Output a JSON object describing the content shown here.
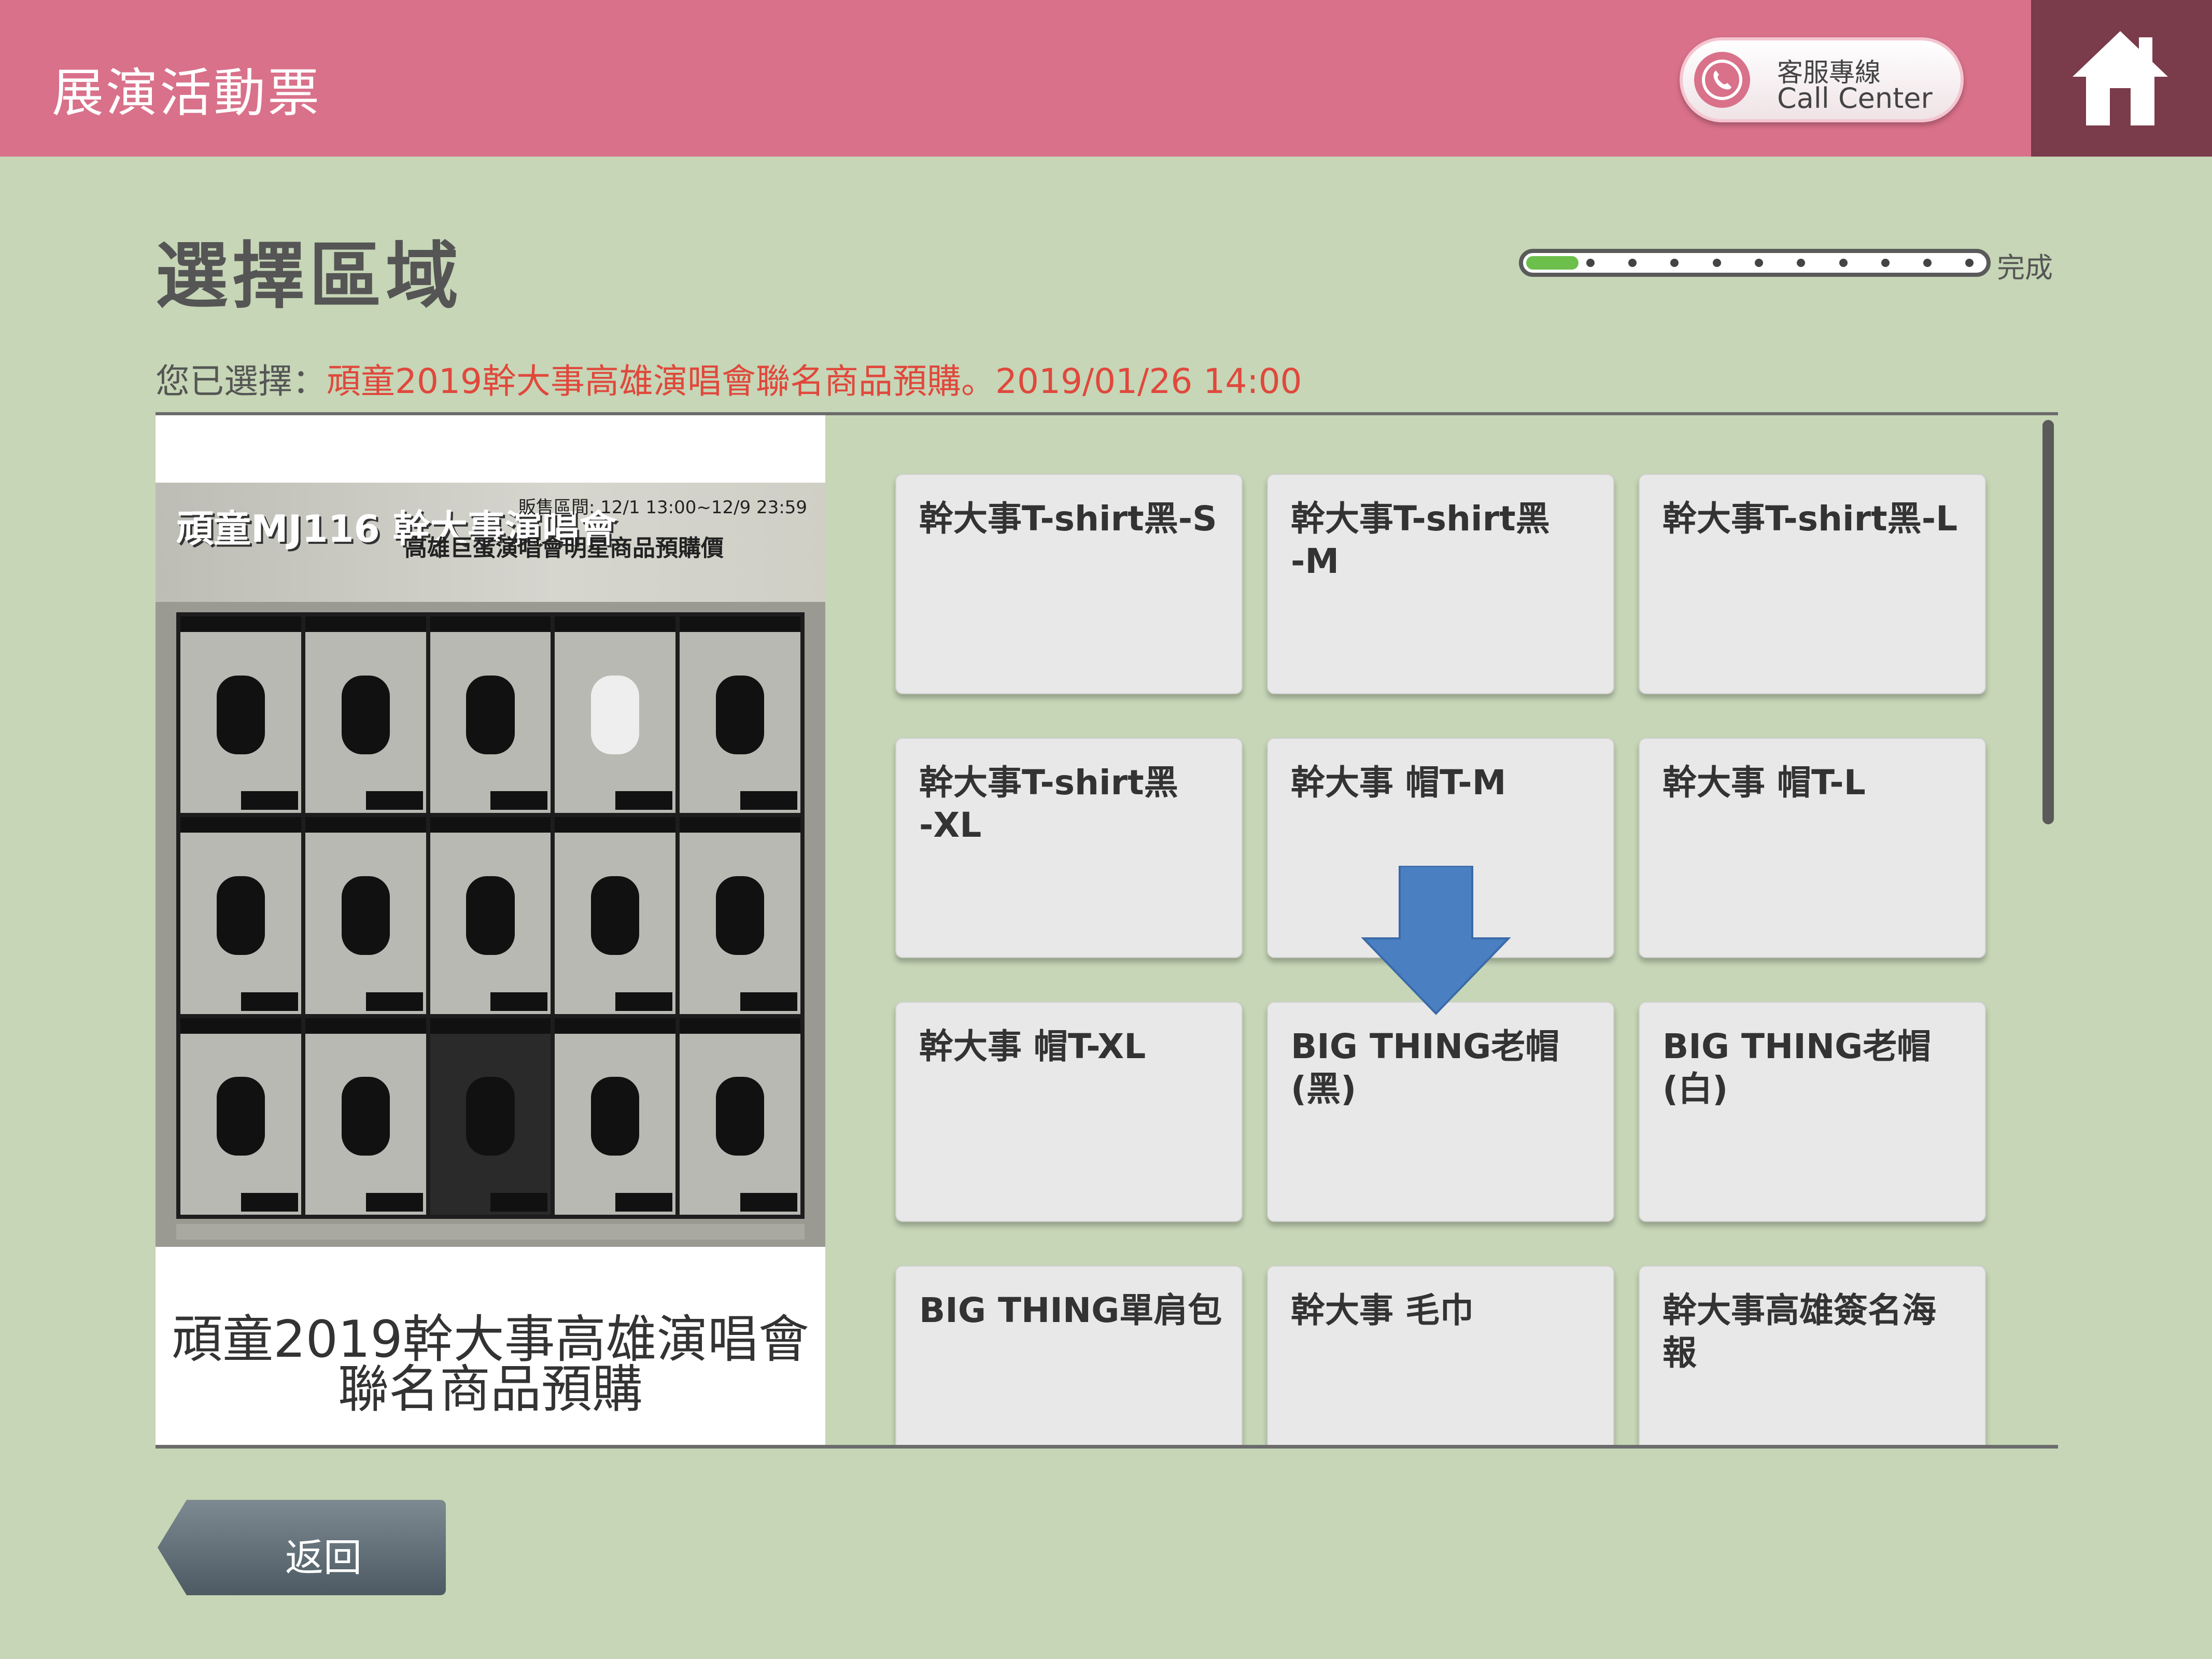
{
  "header": {
    "title": "展演活動票",
    "call_center": {
      "line1": "客服專線",
      "line2": "Call Center",
      "icon": "phone-icon"
    },
    "home_icon": "home-icon"
  },
  "page": {
    "title": "選擇區域",
    "progress": {
      "end_label": "完成",
      "current_step": 1,
      "total_steps": 11
    },
    "selection": {
      "label": "您已選擇：",
      "value": "頑童2019幹大事高雄演唱會聯名商品預購。2019/01/26 14:00"
    }
  },
  "event": {
    "name": "頑童2019幹大事高雄演唱會\n聯名商品預購",
    "poster": {
      "title": "頑童MJ116 幹大事演唱會",
      "subtitle": "高雄巨蛋演唱會明星商品預購價",
      "sale_period": "販售區間: 12/1 13:00~12/9 23:59"
    }
  },
  "products": [
    {
      "label": "幹大事T-shirt黑-S"
    },
    {
      "label": "幹大事T-shirt黑\n-M"
    },
    {
      "label": "幹大事T-shirt黑-L"
    },
    {
      "label": "幹大事T-shirt黑\n-XL"
    },
    {
      "label": "幹大事 帽T-M"
    },
    {
      "label": "幹大事 帽T-L"
    },
    {
      "label": "幹大事 帽T-XL"
    },
    {
      "label": "BIG THING老帽\n(黑)"
    },
    {
      "label": "BIG THING老帽\n(白)"
    },
    {
      "label": "BIG THING單肩包"
    },
    {
      "label": "幹大事 毛巾"
    },
    {
      "label": "幹大事高雄簽名海\n報"
    }
  ],
  "back_button": {
    "label": "返回"
  },
  "colors": {
    "header": "#d9718a",
    "home": "#7a3b4b",
    "background": "#c6d6b6",
    "selection_value": "#e0483c",
    "progress_fill": "#6bbf4a",
    "arrow": "#4a7fc1"
  }
}
